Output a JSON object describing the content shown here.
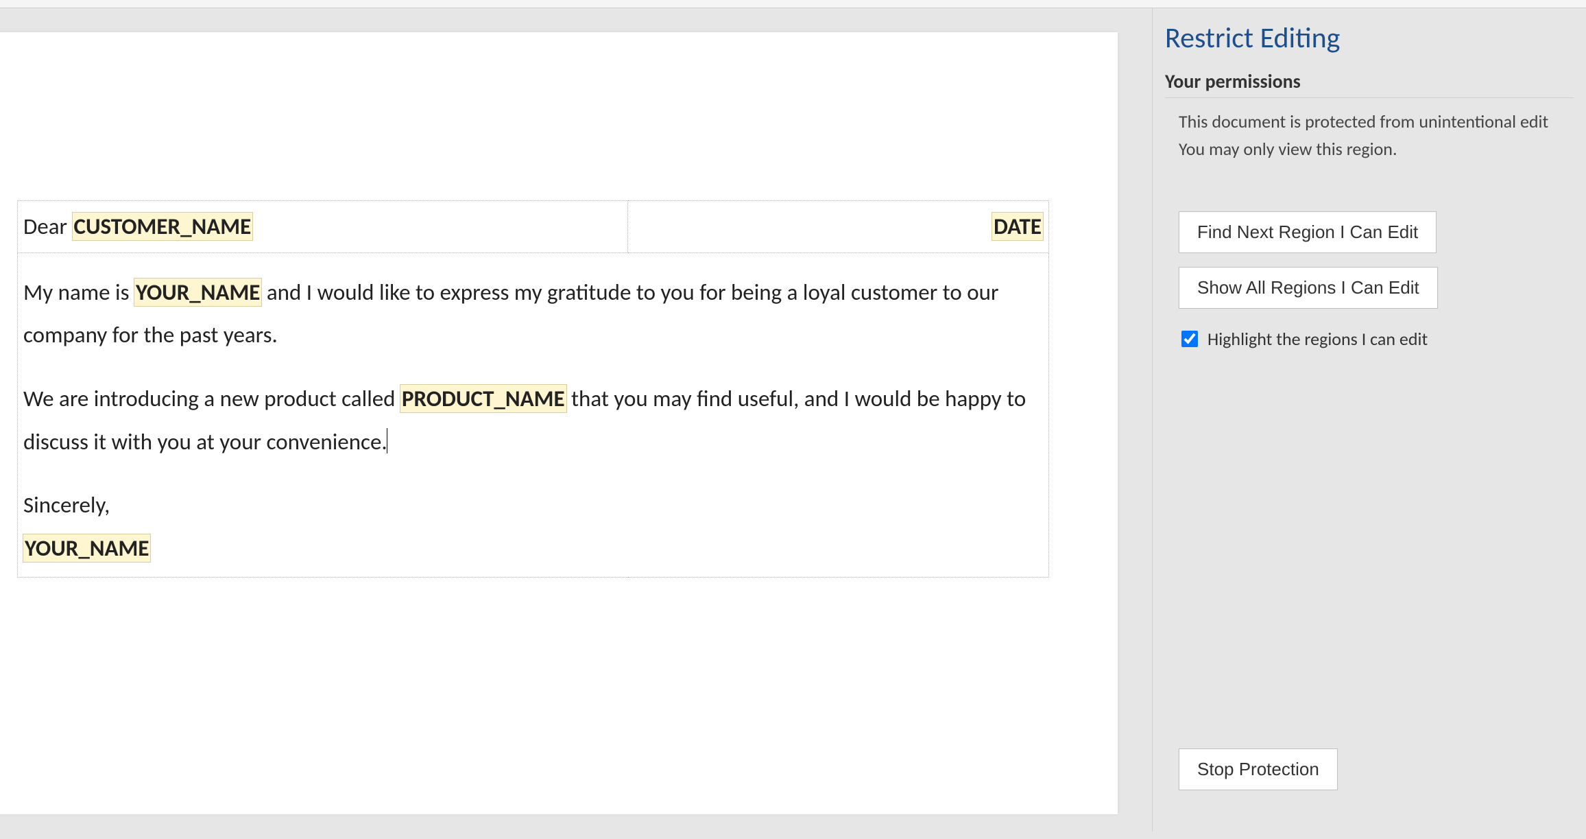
{
  "document": {
    "greeting_prefix": "Dear ",
    "field_customer_name": "CUSTOMER_NAME",
    "field_date": "DATE",
    "body_p1_a": "My name is ",
    "field_your_name": "YOUR_NAME",
    "body_p1_b": " and I would like to express my gratitude to you for being a loyal customer to our company for the past years.",
    "body_p2_a": "We are introducing a new product called ",
    "field_product_name": "PRODUCT_NAME",
    "body_p2_b": " that you may find useful, and I would be happy to discuss it with you at your convenience.",
    "closing": "Sincerely,",
    "field_signature": "YOUR_NAME"
  },
  "panel": {
    "title": "Restrict Editing",
    "permissions_heading": "Your permissions",
    "permissions_line1": "This document is protected from unintentional edit",
    "permissions_line2": "You may only view this region.",
    "btn_find_next": "Find Next Region I Can Edit",
    "btn_show_all": "Show All Regions I Can Edit",
    "chk_highlight_label": "Highlight the regions I can edit",
    "chk_highlight_checked": true,
    "btn_stop": "Stop Protection"
  }
}
